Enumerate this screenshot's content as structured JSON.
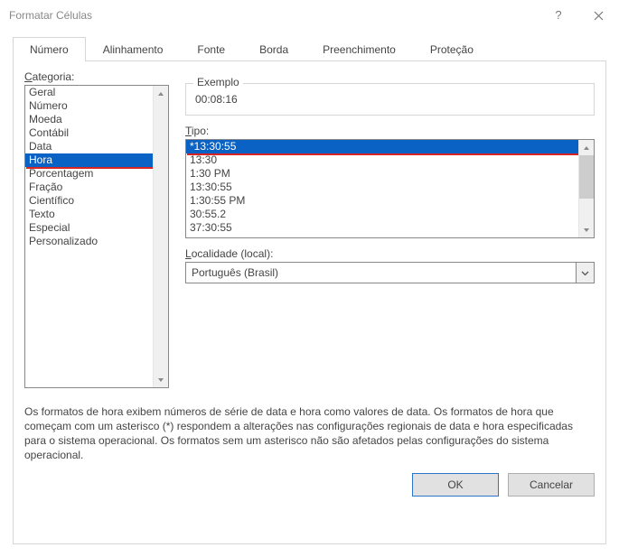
{
  "titlebar": {
    "title": "Formatar Células"
  },
  "tabs": {
    "items": [
      {
        "label": "Número"
      },
      {
        "label": "Alinhamento"
      },
      {
        "label": "Fonte"
      },
      {
        "label": "Borda"
      },
      {
        "label": "Preenchimento"
      },
      {
        "label": "Proteção"
      }
    ],
    "active_index": 0
  },
  "category": {
    "label_prefix": "C",
    "label_rest": "ategoria:",
    "items": [
      "Geral",
      "Número",
      "Moeda",
      "Contábil",
      "Data",
      "Hora",
      "Porcentagem",
      "Fração",
      "Científico",
      "Texto",
      "Especial",
      "Personalizado"
    ],
    "selected_index": 5
  },
  "sample": {
    "legend": "Exemplo",
    "value": "00:08:16"
  },
  "type": {
    "label_prefix": "T",
    "label_rest": "ipo:",
    "items": [
      "*13:30:55",
      "13:30",
      "1:30 PM",
      "13:30:55",
      "1:30:55 PM",
      "30:55.2",
      "37:30:55"
    ],
    "selected_index": 0
  },
  "locale": {
    "label_prefix": "L",
    "label_rest": "ocalidade (local):",
    "value": "Português (Brasil)"
  },
  "description": "Os formatos de hora exibem números de série de data e hora como valores de data. Os formatos de hora que começam com um asterisco (*) respondem a alterações nas configurações regionais de data e hora especificadas para o sistema operacional. Os formatos sem um asterisco não são afetados pelas configurações do sistema operacional.",
  "footer": {
    "ok": "OK",
    "cancel": "Cancelar"
  }
}
